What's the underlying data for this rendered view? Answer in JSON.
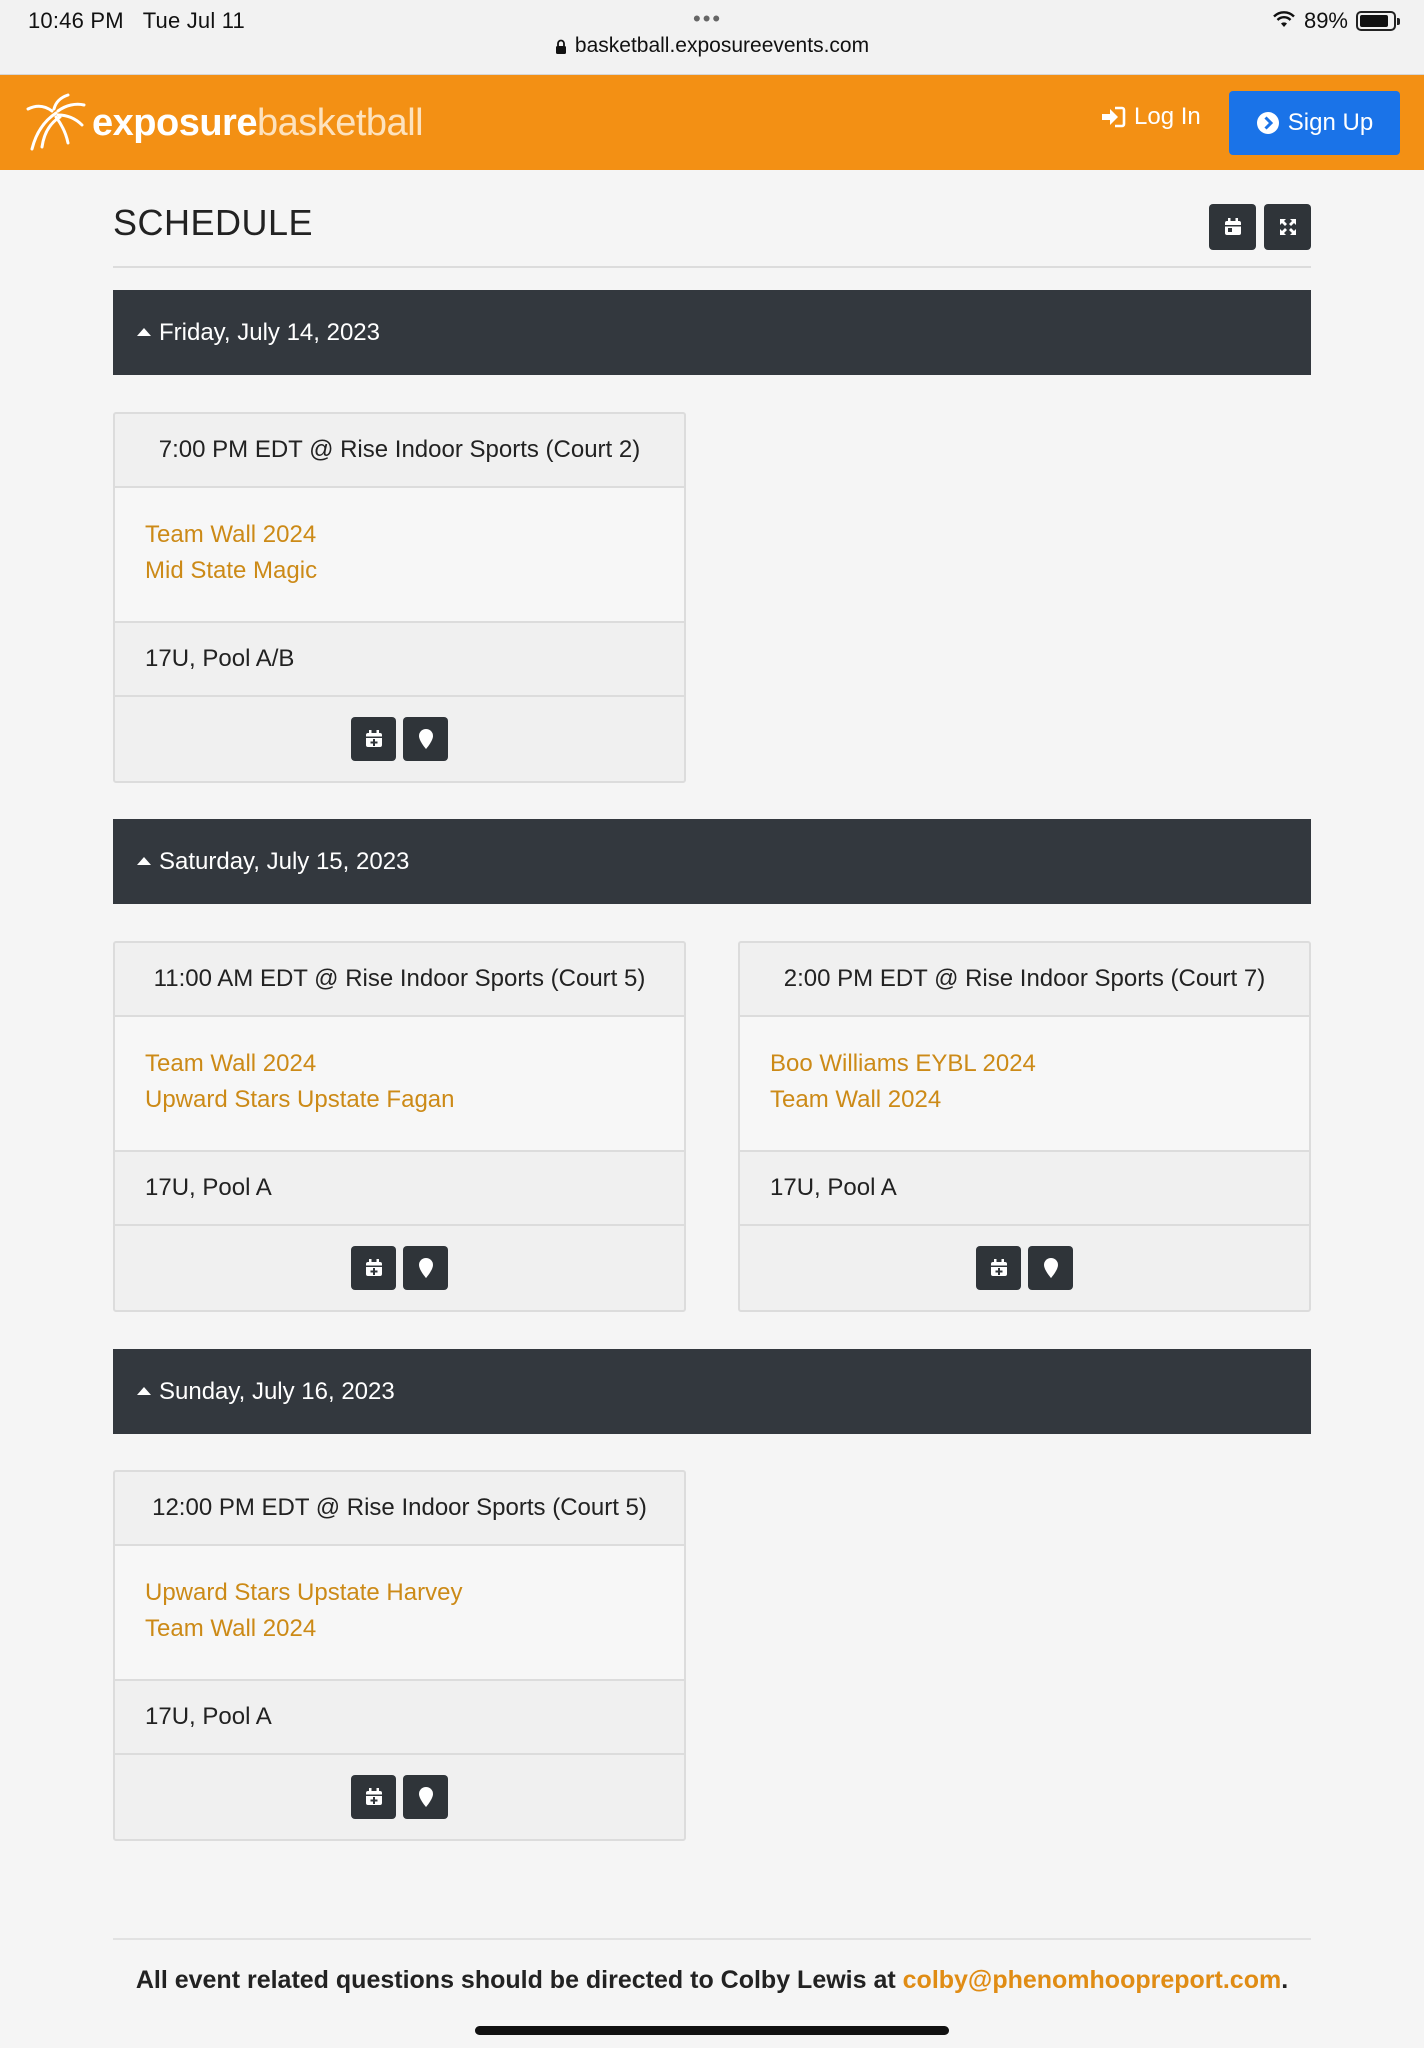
{
  "status_bar": {
    "time": "10:46 PM",
    "date": "Tue Jul 11",
    "url": "basketball.exposureevents.com",
    "battery": "89%",
    "battery_level": 0.89
  },
  "header": {
    "logo_bold": "exposure",
    "logo_light": "basketball",
    "login_label": "Log In",
    "signup_label": "Sign Up",
    "brand_color": "#f39014",
    "signup_color": "#1a73e8"
  },
  "schedule": {
    "title": "SCHEDULE",
    "days": [
      {
        "label": "Friday, July 14, 2023",
        "games": [
          {
            "time_location": "7:00 PM EDT @ Rise Indoor Sports (Court 2)",
            "teams": [
              "Team Wall 2024",
              "Mid State Magic"
            ],
            "division": "17U, Pool A/B"
          }
        ]
      },
      {
        "label": "Saturday, July 15, 2023",
        "games": [
          {
            "time_location": "11:00 AM EDT @ Rise Indoor Sports (Court 5)",
            "teams": [
              "Team Wall 2024",
              "Upward Stars Upstate Fagan"
            ],
            "division": "17U, Pool A"
          },
          {
            "time_location": "2:00 PM EDT @ Rise Indoor Sports (Court 7)",
            "teams": [
              "Boo Williams EYBL 2024",
              "Team Wall 2024"
            ],
            "division": "17U, Pool A"
          }
        ]
      },
      {
        "label": "Sunday, July 16, 2023",
        "games": [
          {
            "time_location": "12:00 PM EDT @ Rise Indoor Sports (Court 5)",
            "teams": [
              "Upward Stars Upstate Harvey",
              "Team Wall 2024"
            ],
            "division": "17U, Pool A"
          }
        ]
      }
    ]
  },
  "footer": {
    "text": "All event related questions should be directed to Colby Lewis at ",
    "email": "colby@phenomhoopreport.com",
    "end": "."
  }
}
